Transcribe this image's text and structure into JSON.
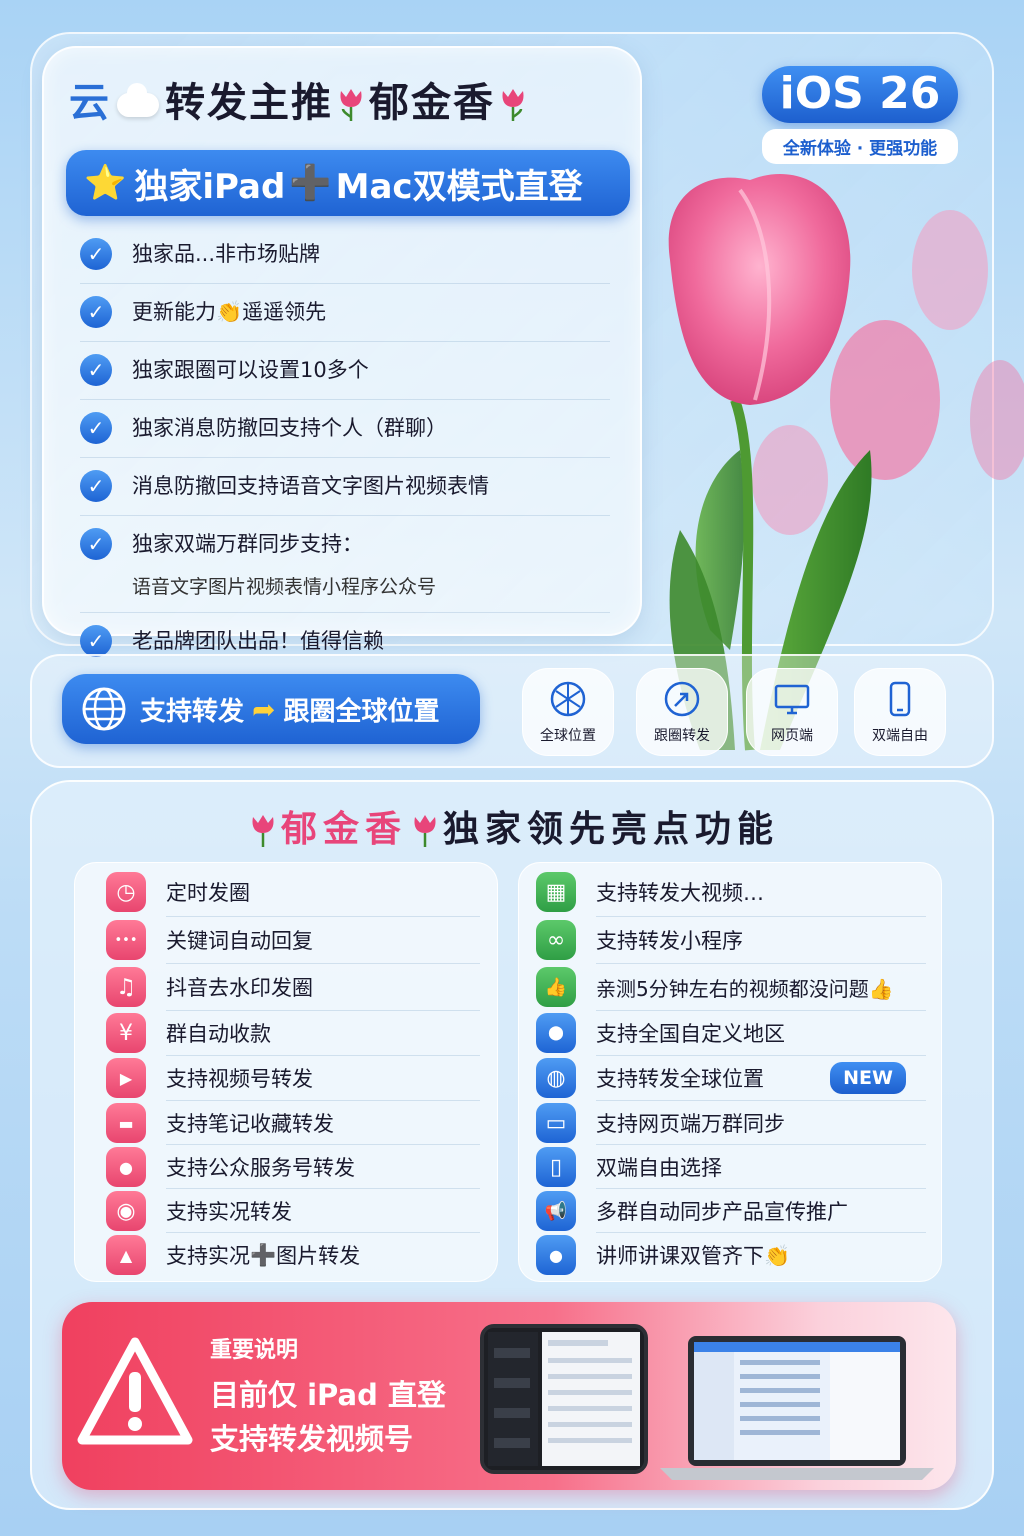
{
  "header": {
    "cloud_word": "云",
    "title": "转发主推",
    "brand": "郁金香"
  },
  "banner": {
    "star": "⭐",
    "text_a": "独家iPad",
    "plus": "➕",
    "text_b": "Mac双模式直登"
  },
  "features": [
    {
      "text": "独家品...非市场贴牌"
    },
    {
      "text": "更新能力👏遥遥领先"
    },
    {
      "text": "独家跟圈可以设置10多个"
    },
    {
      "text": "独家消息防撤回支持个人（群聊）"
    },
    {
      "text": "消息防撤回支持语音文字图片视频表情"
    },
    {
      "text": "独家双端万群同步支持：",
      "sub": "语音文字图片视频表情小程序公众号"
    },
    {
      "text": "老品牌团队出品！值得信赖"
    }
  ],
  "ios_badge": {
    "version": "iOS 26",
    "tagline": "全新体验 · 更强功能"
  },
  "mid": {
    "pill_a": "支持转发",
    "arrow": "➦",
    "pill_b": "跟圈全球位置",
    "tiles": [
      {
        "label": "全球位置",
        "icon": "globe-icon"
      },
      {
        "label": "跟圈转发",
        "icon": "share-arrow-icon"
      },
      {
        "label": "网页端",
        "icon": "monitor-icon"
      },
      {
        "label": "双端自由",
        "icon": "phone-icon"
      }
    ]
  },
  "section": {
    "brand": "郁金香",
    "title": "独家领先亮点功能"
  },
  "left_list": [
    {
      "label": "定时发圈",
      "icon": "clock-icon",
      "glyph": "◷"
    },
    {
      "label": "关键词自动回复",
      "icon": "chat-bubble-icon",
      "glyph": "•••"
    },
    {
      "label": "抖音去水印发圈",
      "icon": "music-note-icon",
      "glyph": "♫"
    },
    {
      "label": "群自动收款",
      "icon": "money-bag-icon",
      "glyph": "¥"
    },
    {
      "label": "支持视频号转发",
      "icon": "play-icon",
      "glyph": "▶"
    },
    {
      "label": "支持笔记收藏转发",
      "icon": "folder-icon",
      "glyph": "▬"
    },
    {
      "label": "支持公众服务号转发",
      "icon": "person-icon",
      "glyph": "●"
    },
    {
      "label": "支持实况转发",
      "icon": "live-circle-icon",
      "glyph": "◉"
    },
    {
      "label_a": "支持实况",
      "plus": "➕",
      "label_b": "图片转发",
      "icon": "image-icon",
      "glyph": "▲"
    }
  ],
  "right_list": [
    {
      "label": "支持转发大视频…",
      "icon": "film-icon",
      "glyph": "▦",
      "color": "green"
    },
    {
      "label": "支持转发小程序",
      "icon": "mini-program-icon",
      "glyph": "∞",
      "color": "green"
    },
    {
      "label": "亲测5分钟左右的视频都没问题👍",
      "icon": "thumbs-up-icon",
      "glyph": "👍",
      "color": "green"
    },
    {
      "label": "支持全国自定义地区",
      "icon": "location-pin-icon",
      "glyph": "⬤",
      "color": "blue"
    },
    {
      "label": "支持转发全球位置",
      "icon": "globe-icon",
      "glyph": "◍",
      "color": "blue"
    },
    {
      "label": "支持网页端万群同步",
      "icon": "monitor-icon",
      "glyph": "▭",
      "color": "blue"
    },
    {
      "label": "双端自由选择",
      "icon": "phone-icon",
      "glyph": "▯",
      "color": "blue"
    },
    {
      "label": "多群自动同步产品宣传推广",
      "icon": "megaphone-icon",
      "glyph": "📢",
      "color": "blue"
    },
    {
      "label": "讲师讲课双管齐下👏",
      "icon": "teacher-icon",
      "glyph": "●",
      "color": "blue"
    }
  ],
  "new_badge": "NEW",
  "notice": {
    "label": "重要说明",
    "line1": "目前仅 iPad 直登",
    "line2": "支持转发视频号"
  },
  "colors": {
    "primary_blue": "#1f63d3",
    "accent_pink": "#e8457a",
    "green": "#2f9e45"
  }
}
